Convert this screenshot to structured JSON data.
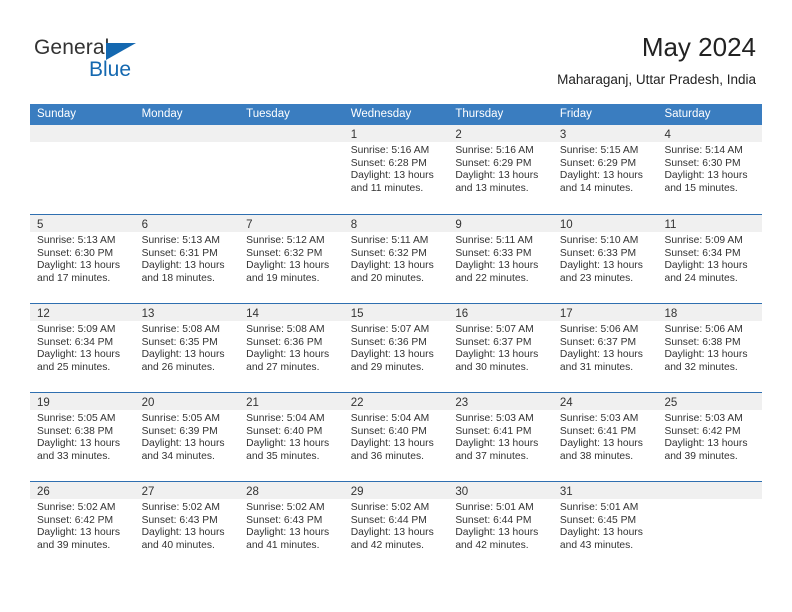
{
  "brand": {
    "name_part1": "General",
    "name_part2": "Blue",
    "accent_color": "#1468b0"
  },
  "header": {
    "title": "May 2024",
    "subtitle": "Maharaganj, Uttar Pradesh, India"
  },
  "theme": {
    "header_row_color": "#3a7dc0",
    "week_divider_color": "#2f6fb0",
    "day_band_color": "#f0f0f0"
  },
  "weekday_headers": [
    "Sunday",
    "Monday",
    "Tuesday",
    "Wednesday",
    "Thursday",
    "Friday",
    "Saturday"
  ],
  "weeks": [
    [
      {
        "day": "",
        "lines": []
      },
      {
        "day": "",
        "lines": []
      },
      {
        "day": "",
        "lines": []
      },
      {
        "day": "1",
        "lines": [
          "Sunrise: 5:16 AM",
          "Sunset: 6:28 PM",
          "Daylight: 13 hours",
          "and 11 minutes."
        ]
      },
      {
        "day": "2",
        "lines": [
          "Sunrise: 5:16 AM",
          "Sunset: 6:29 PM",
          "Daylight: 13 hours",
          "and 13 minutes."
        ]
      },
      {
        "day": "3",
        "lines": [
          "Sunrise: 5:15 AM",
          "Sunset: 6:29 PM",
          "Daylight: 13 hours",
          "and 14 minutes."
        ]
      },
      {
        "day": "4",
        "lines": [
          "Sunrise: 5:14 AM",
          "Sunset: 6:30 PM",
          "Daylight: 13 hours",
          "and 15 minutes."
        ]
      }
    ],
    [
      {
        "day": "5",
        "lines": [
          "Sunrise: 5:13 AM",
          "Sunset: 6:30 PM",
          "Daylight: 13 hours",
          "and 17 minutes."
        ]
      },
      {
        "day": "6",
        "lines": [
          "Sunrise: 5:13 AM",
          "Sunset: 6:31 PM",
          "Daylight: 13 hours",
          "and 18 minutes."
        ]
      },
      {
        "day": "7",
        "lines": [
          "Sunrise: 5:12 AM",
          "Sunset: 6:32 PM",
          "Daylight: 13 hours",
          "and 19 minutes."
        ]
      },
      {
        "day": "8",
        "lines": [
          "Sunrise: 5:11 AM",
          "Sunset: 6:32 PM",
          "Daylight: 13 hours",
          "and 20 minutes."
        ]
      },
      {
        "day": "9",
        "lines": [
          "Sunrise: 5:11 AM",
          "Sunset: 6:33 PM",
          "Daylight: 13 hours",
          "and 22 minutes."
        ]
      },
      {
        "day": "10",
        "lines": [
          "Sunrise: 5:10 AM",
          "Sunset: 6:33 PM",
          "Daylight: 13 hours",
          "and 23 minutes."
        ]
      },
      {
        "day": "11",
        "lines": [
          "Sunrise: 5:09 AM",
          "Sunset: 6:34 PM",
          "Daylight: 13 hours",
          "and 24 minutes."
        ]
      }
    ],
    [
      {
        "day": "12",
        "lines": [
          "Sunrise: 5:09 AM",
          "Sunset: 6:34 PM",
          "Daylight: 13 hours",
          "and 25 minutes."
        ]
      },
      {
        "day": "13",
        "lines": [
          "Sunrise: 5:08 AM",
          "Sunset: 6:35 PM",
          "Daylight: 13 hours",
          "and 26 minutes."
        ]
      },
      {
        "day": "14",
        "lines": [
          "Sunrise: 5:08 AM",
          "Sunset: 6:36 PM",
          "Daylight: 13 hours",
          "and 27 minutes."
        ]
      },
      {
        "day": "15",
        "lines": [
          "Sunrise: 5:07 AM",
          "Sunset: 6:36 PM",
          "Daylight: 13 hours",
          "and 29 minutes."
        ]
      },
      {
        "day": "16",
        "lines": [
          "Sunrise: 5:07 AM",
          "Sunset: 6:37 PM",
          "Daylight: 13 hours",
          "and 30 minutes."
        ]
      },
      {
        "day": "17",
        "lines": [
          "Sunrise: 5:06 AM",
          "Sunset: 6:37 PM",
          "Daylight: 13 hours",
          "and 31 minutes."
        ]
      },
      {
        "day": "18",
        "lines": [
          "Sunrise: 5:06 AM",
          "Sunset: 6:38 PM",
          "Daylight: 13 hours",
          "and 32 minutes."
        ]
      }
    ],
    [
      {
        "day": "19",
        "lines": [
          "Sunrise: 5:05 AM",
          "Sunset: 6:38 PM",
          "Daylight: 13 hours",
          "and 33 minutes."
        ]
      },
      {
        "day": "20",
        "lines": [
          "Sunrise: 5:05 AM",
          "Sunset: 6:39 PM",
          "Daylight: 13 hours",
          "and 34 minutes."
        ]
      },
      {
        "day": "21",
        "lines": [
          "Sunrise: 5:04 AM",
          "Sunset: 6:40 PM",
          "Daylight: 13 hours",
          "and 35 minutes."
        ]
      },
      {
        "day": "22",
        "lines": [
          "Sunrise: 5:04 AM",
          "Sunset: 6:40 PM",
          "Daylight: 13 hours",
          "and 36 minutes."
        ]
      },
      {
        "day": "23",
        "lines": [
          "Sunrise: 5:03 AM",
          "Sunset: 6:41 PM",
          "Daylight: 13 hours",
          "and 37 minutes."
        ]
      },
      {
        "day": "24",
        "lines": [
          "Sunrise: 5:03 AM",
          "Sunset: 6:41 PM",
          "Daylight: 13 hours",
          "and 38 minutes."
        ]
      },
      {
        "day": "25",
        "lines": [
          "Sunrise: 5:03 AM",
          "Sunset: 6:42 PM",
          "Daylight: 13 hours",
          "and 39 minutes."
        ]
      }
    ],
    [
      {
        "day": "26",
        "lines": [
          "Sunrise: 5:02 AM",
          "Sunset: 6:42 PM",
          "Daylight: 13 hours",
          "and 39 minutes."
        ]
      },
      {
        "day": "27",
        "lines": [
          "Sunrise: 5:02 AM",
          "Sunset: 6:43 PM",
          "Daylight: 13 hours",
          "and 40 minutes."
        ]
      },
      {
        "day": "28",
        "lines": [
          "Sunrise: 5:02 AM",
          "Sunset: 6:43 PM",
          "Daylight: 13 hours",
          "and 41 minutes."
        ]
      },
      {
        "day": "29",
        "lines": [
          "Sunrise: 5:02 AM",
          "Sunset: 6:44 PM",
          "Daylight: 13 hours",
          "and 42 minutes."
        ]
      },
      {
        "day": "30",
        "lines": [
          "Sunrise: 5:01 AM",
          "Sunset: 6:44 PM",
          "Daylight: 13 hours",
          "and 42 minutes."
        ]
      },
      {
        "day": "31",
        "lines": [
          "Sunrise: 5:01 AM",
          "Sunset: 6:45 PM",
          "Daylight: 13 hours",
          "and 43 minutes."
        ]
      },
      {
        "day": "",
        "lines": []
      }
    ]
  ]
}
